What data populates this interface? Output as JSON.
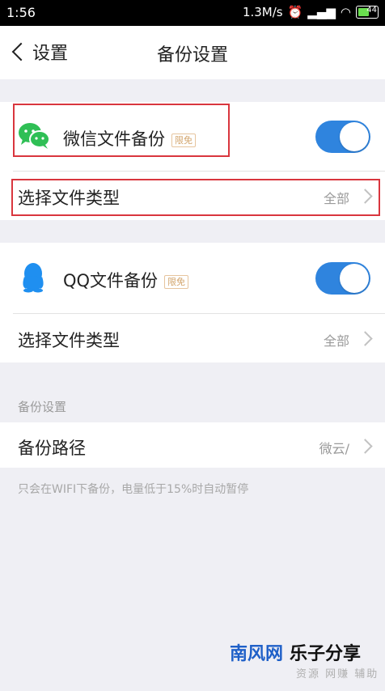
{
  "statusbar": {
    "time": "1:56",
    "speed": "1.3M/s",
    "battery": "44"
  },
  "navbar": {
    "back_label": "设置",
    "title": "备份设置"
  },
  "wechat": {
    "label": "微信文件备份",
    "badge": "限免",
    "toggle_on": true,
    "type_label": "选择文件类型",
    "type_value": "全部",
    "icon": "wechat-icon",
    "color": "#2fbf55"
  },
  "qq": {
    "label": "QQ文件备份",
    "badge": "限免",
    "toggle_on": true,
    "type_label": "选择文件类型",
    "type_value": "全部",
    "icon": "qq-icon",
    "color": "#1f8ff0"
  },
  "backup": {
    "header": "备份设置",
    "path_label": "备份路径",
    "path_value": "微云/",
    "note": "只会在WIFI下备份，电量低于15%时自动暂停"
  },
  "watermark": {
    "brand_blue": "南风网",
    "brand_black": "乐子分享",
    "sub": "资源 网赚 辅助"
  },
  "colors": {
    "accent": "#2f84de",
    "highlight": "#d9363e",
    "background": "#efeff4"
  }
}
